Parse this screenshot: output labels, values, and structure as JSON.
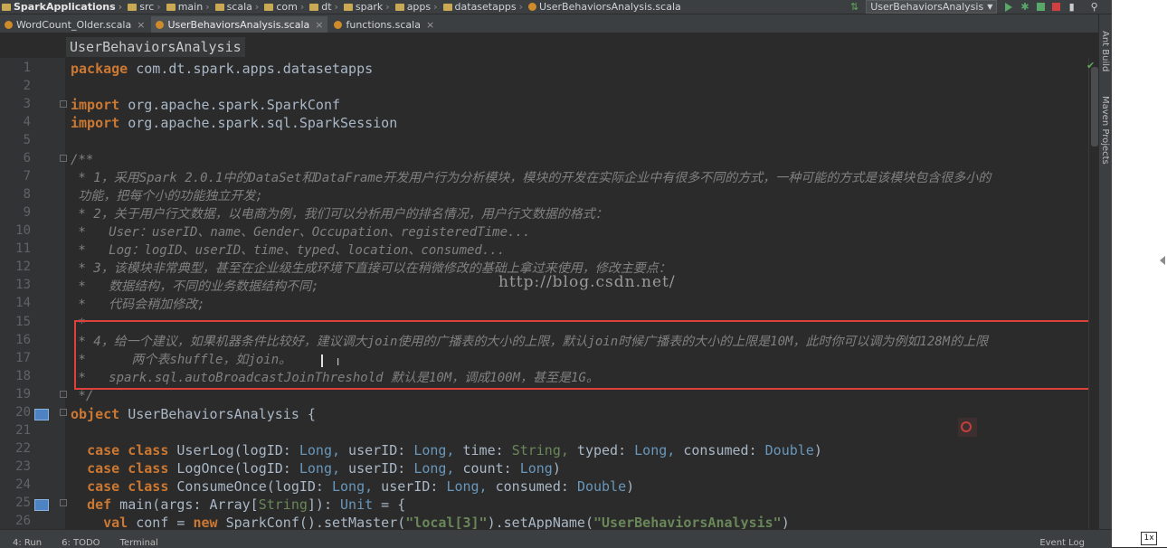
{
  "navbar": {
    "crumbs": [
      "SparkApplications",
      "src",
      "main",
      "scala",
      "com",
      "dt",
      "spark",
      "apps",
      "datasetapps",
      "UserBehaviorsAnalysis.scala"
    ],
    "run_config": "UserBehaviorsAnalysis"
  },
  "tabs": [
    {
      "label": "WordCount_Older.scala",
      "close": "×"
    },
    {
      "label": "UserBehaviorsAnalysis.scala",
      "close": "×"
    },
    {
      "label": "functions.scala",
      "close": "×"
    }
  ],
  "editor": {
    "header": "UserBehaviorsAnalysis",
    "line_numbers": [
      "1",
      "2",
      "3",
      "4",
      "5",
      "6",
      "7",
      "8",
      "9",
      "10",
      "11",
      "12",
      "13",
      "14",
      "15",
      "16",
      "17",
      "18",
      "19",
      "20",
      "21",
      "22",
      "23",
      "24",
      "25",
      "26"
    ],
    "lines": {
      "l1a": "package",
      "l1b": " com.dt.spark.apps.datasetapps",
      "l3a": "import",
      "l3b": " org.apache.spark.SparkConf",
      "l4a": "import",
      "l4b": " org.apache.spark.sql.SparkSession",
      "l6": "/**",
      "l7": " * 1，采用Spark 2.0.1中的DataSet和DataFrame开发用户行为分析模块，模块的开发在实际企业中有很多不同的方式，一种可能的方式是该模块包含很多小的",
      "l8": " 功能，把每个小的功能独立开发;",
      "l9": " * 2，关于用户行文数据，以电商为例，我们可以分析用户的排名情况，用户行文数据的格式：",
      "l10": " *   User：userID、name、Gender、Occupation、registeredTime...",
      "l11": " *   Log：logID、userID、time、typed、location、consumed...",
      "l12": " * 3，该模块非常典型，甚至在企业级生成环境下直接可以在稍微修改的基础上拿过来使用，修改主要点：",
      "l13": " *   数据结构，不同的业务数据结构不同;",
      "l14": " *   代码会稍加修改;",
      "l15": " *",
      "l16": " * 4，给一个建议，如果机器条件比较好，建议调大join使用的广播表的大小的上限，默认join时候广播表的大小的上限是10M，此时你可以调为例如128M的上限",
      "l17": " *      两个表shuffle，如join。",
      "l18": " *   spark.sql.autoBroadcastJoinThreshold 默认是10M，调成100M，甚至是1G。",
      "l19": " */",
      "l20a": "object",
      "l20b": " UserBehaviorsAnalysis {",
      "l22a": "case class",
      "l22b": " UserLog(logID: ",
      "l22c": "Long,",
      "l22d": " userID: ",
      "l22e": "Long,",
      "l22f": " time: ",
      "l22g": "String,",
      "l22h": " typed: ",
      "l22i": "Long,",
      "l22j": " consumed: ",
      "l22k": "Double",
      "l22l": ")",
      "l23a": "case class",
      "l23b": " LogOnce(logID: ",
      "l23c": "Long,",
      "l23d": " userID: ",
      "l23e": "Long,",
      "l23f": " count: ",
      "l23g": "Long",
      "l23h": ")",
      "l24a": "case class",
      "l24b": " ConsumeOnce(logID: ",
      "l24c": "Long,",
      "l24d": " userID: ",
      "l24e": "Long,",
      "l24f": " consumed: ",
      "l24g": "Double",
      "l24h": ")",
      "l25a": "def",
      "l25b": " main(args: Array[",
      "l25c": "String",
      "l25d": "]): ",
      "l25e": "Unit",
      "l25f": " = {",
      "l26a": "val",
      "l26b": " conf = ",
      "l26c": "new",
      "l26d": " SparkConf().setMaster(",
      "l26e": "\"local[3]\"",
      "l26f": ").setAppName(",
      "l26g": "\"UserBehaviorsAnalysis\"",
      "l26h": ")"
    },
    "watermark": "http://blog.csdn.net/"
  },
  "sidebar": {
    "ant_build": "Ant Build",
    "maven": "Maven Projects"
  },
  "statusbar": {
    "run": "4: Run",
    "todo": "6: TODO",
    "terminal": "Terminal",
    "event_log": "Event Log"
  },
  "zoom": "1x",
  "colors": {
    "keyword": "#cc7832",
    "type": "#6897bb",
    "string": "#6a8759",
    "comment": "#808080",
    "highlight": "#e0403a"
  }
}
